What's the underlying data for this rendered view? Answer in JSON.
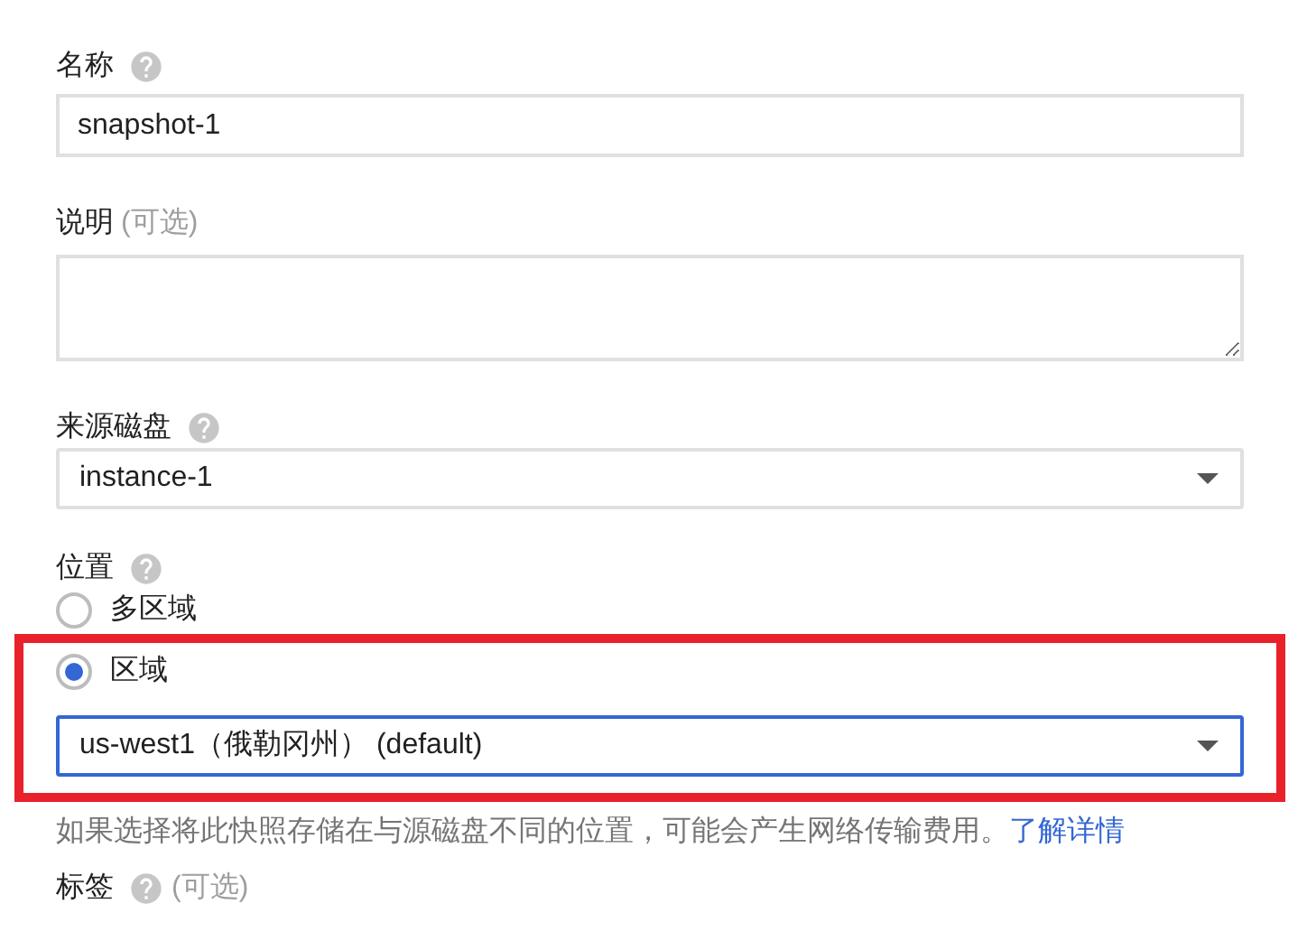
{
  "fields": [
    {
      "kind": "text",
      "label": "名称",
      "help": true,
      "value": "snapshot-1"
    },
    {
      "kind": "textarea",
      "label": "说明",
      "help": false,
      "optional": "(可选)"
    },
    {
      "kind": "select",
      "label": "来源磁盘",
      "help": true,
      "value": "instance-1"
    },
    {
      "kind": "location",
      "label": "位置",
      "help": true,
      "highlighted": true,
      "options": [
        {
          "label": "多区域",
          "selected": false
        },
        {
          "label": "区域",
          "selected": true
        }
      ],
      "value": "us-west1（俄勒冈州） (default)",
      "note": "如果选择将此快照存储在与源磁盘不同的位置，可能会产生网络传输费用。",
      "link": "了解详情"
    },
    {
      "kind": "label",
      "label": "标签",
      "help": true,
      "optional": "(可选)"
    }
  ]
}
